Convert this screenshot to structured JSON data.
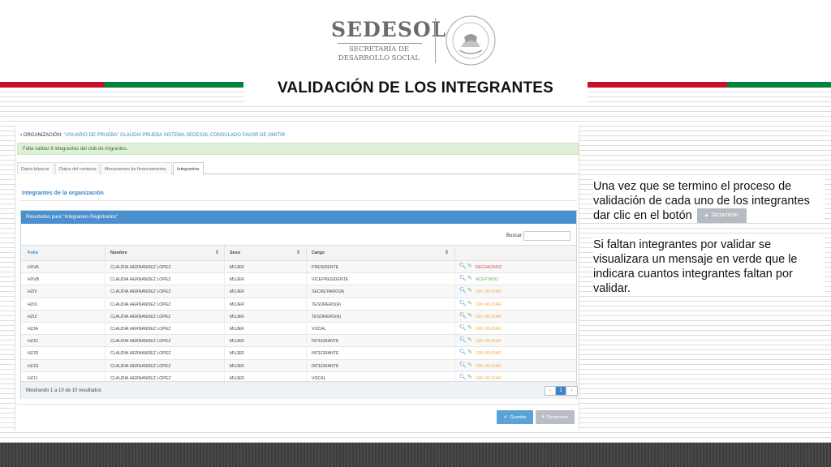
{
  "header": {
    "logo_word": "SEDESOL",
    "logo_line1": "SECRETARÍA DE",
    "logo_line2": "DESARROLLO SOCIAL",
    "seal_icon": "mexico-seal-icon",
    "title": "VALIDACIÓN DE LOS INTEGRANTES",
    "colors": {
      "red": "#c8102e",
      "green": "#00843d"
    }
  },
  "app": {
    "org_label": "ORGANIZACIÓN:",
    "org_value": "\"USUARIO DE PRUEBA\" CLAUDIA PRUEBA SISTEMA SEDESOL CONSULADO FAVOR DE OMITIR",
    "alert": "Falta validar 8 integrantes del club de migrantes.",
    "tabs": [
      "Datos básicos",
      "Datos del contacto",
      "Mecanismos de financiamiento",
      "Integrantes"
    ],
    "section_title": "Integrantes de la organización",
    "panel_title": "Resultados para \"Integrantes Registrados\"",
    "search_label": "Buscar:",
    "columns": [
      "Folio",
      "Nombre",
      "Sexo",
      "Cargo"
    ],
    "rows": [
      {
        "folio": "HXVA",
        "nombre": "CLAUDIA HERNANDEZ LOPEZ",
        "sexo": "MUJER",
        "cargo": "PRESIDENTE",
        "estado": "RECHAZADO"
      },
      {
        "folio": "HXVB",
        "nombre": "CLAUDIA HERNANDEZ LOPEZ",
        "sexo": "MUJER",
        "cargo": "VICEPRESIDENTE",
        "estado": "ACEPTADO"
      },
      {
        "folio": "HZIV",
        "nombre": "CLAUDIA HERNANDEZ LOPEZ",
        "sexo": "MUJER",
        "cargo": "SECRETARIO(A)",
        "estado": "SIN VALIDAR"
      },
      {
        "folio": "HZIX",
        "nombre": "CLAUDIA HERNANDEZ LOPEZ",
        "sexo": "MUJER",
        "cargo": "TESORERO(A)",
        "estado": "SIN VALIDAR"
      },
      {
        "folio": "HZIZ",
        "nombre": "CLAUDIA HERNANDEZ LOPEZ",
        "sexo": "MUJER",
        "cargo": "TESORERO(A)",
        "estado": "SIN VALIDAR"
      },
      {
        "folio": "HZJA",
        "nombre": "CLAUDIA HERNANDEZ LOPEZ",
        "sexo": "MUJER",
        "cargo": "VOCAL",
        "estado": "SIN VALIDAR"
      },
      {
        "folio": "HZJC",
        "nombre": "CLAUDIA HERNANDEZ LOPEZ",
        "sexo": "MUJER",
        "cargo": "INTEGRANTE",
        "estado": "SIN VALIDAR"
      },
      {
        "folio": "HZJD",
        "nombre": "CLAUDIA HERNANDEZ LOPEZ",
        "sexo": "MUJER",
        "cargo": "INTEGRANTE",
        "estado": "SIN VALIDAR"
      },
      {
        "folio": "HZJG",
        "nombre": "CLAUDIA HERNANDEZ LOPEZ",
        "sexo": "MUJER",
        "cargo": "INTEGRANTE",
        "estado": "SIN VALIDAR"
      },
      {
        "folio": "HZJJ",
        "nombre": "CLAUDIA HERNANDEZ LOPEZ",
        "sexo": "MUJER",
        "cargo": "VOCAL",
        "estado": "SIN VALIDAR"
      }
    ],
    "footer_text": "Mostrando 1 a 10 de 10 resultados",
    "pager": [
      "‹",
      "1",
      "›"
    ],
    "save_label": "Guardar",
    "dict_label": "Dictaminar",
    "icons": {
      "view": "search-icon",
      "edit": "pencil-icon",
      "save": "check-icon",
      "dict": "lock-icon"
    }
  },
  "side": {
    "p1": "Una vez que se termino el proceso de validación de cada uno de los integrantes dar clic en el botón",
    "p1_button": "Dictaminar",
    "p2": "Si faltan integrantes por validar se visualizara un mensaje en verde que le indicara cuantos integrantes faltan por validar."
  }
}
